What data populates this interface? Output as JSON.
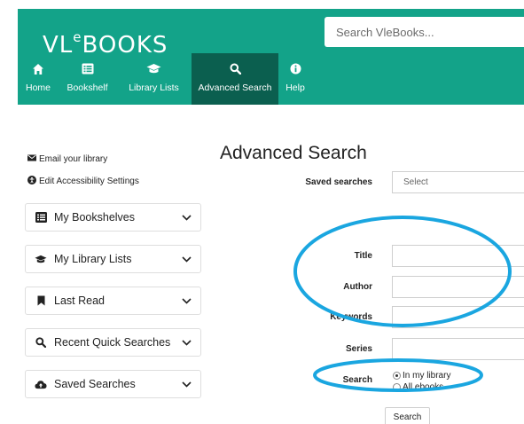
{
  "header": {
    "logo_main": "VL",
    "logo_small": "e",
    "logo_rest": "BOOKS",
    "search_placeholder": "Search VleBooks...",
    "color": "#13a389",
    "active_color": "#0b5f4f"
  },
  "nav": [
    {
      "label": "Home",
      "icon": "home-icon"
    },
    {
      "label": "Bookshelf",
      "icon": "list-icon"
    },
    {
      "label": "Library Lists",
      "icon": "graduation-cap-icon"
    },
    {
      "label": "Advanced Search",
      "icon": "search-icon",
      "active": true
    },
    {
      "label": "Help",
      "icon": "info-icon"
    }
  ],
  "sidebar": {
    "email_link": "Email your library",
    "accessibility_link": "Edit Accessibility Settings",
    "panels": [
      {
        "label": "My Bookshelves",
        "icon": "list-icon"
      },
      {
        "label": "My Library Lists",
        "icon": "graduation-cap-icon"
      },
      {
        "label": "Last Read",
        "icon": "bookmark-icon"
      },
      {
        "label": "Recent Quick Searches",
        "icon": "search-icon"
      },
      {
        "label": "Saved Searches",
        "icon": "cloud-icon"
      }
    ]
  },
  "form": {
    "title": "Advanced Search",
    "saved_searches_label": "Saved searches",
    "saved_searches_value": "Select",
    "title_label": "Title",
    "author_label": "Author",
    "keywords_label": "Keywords",
    "series_label": "Series",
    "search_label": "Search",
    "option_library": "In my library",
    "option_all": "All ebooks",
    "search_button": "Search"
  },
  "annotation_color": "#1aa6e0"
}
